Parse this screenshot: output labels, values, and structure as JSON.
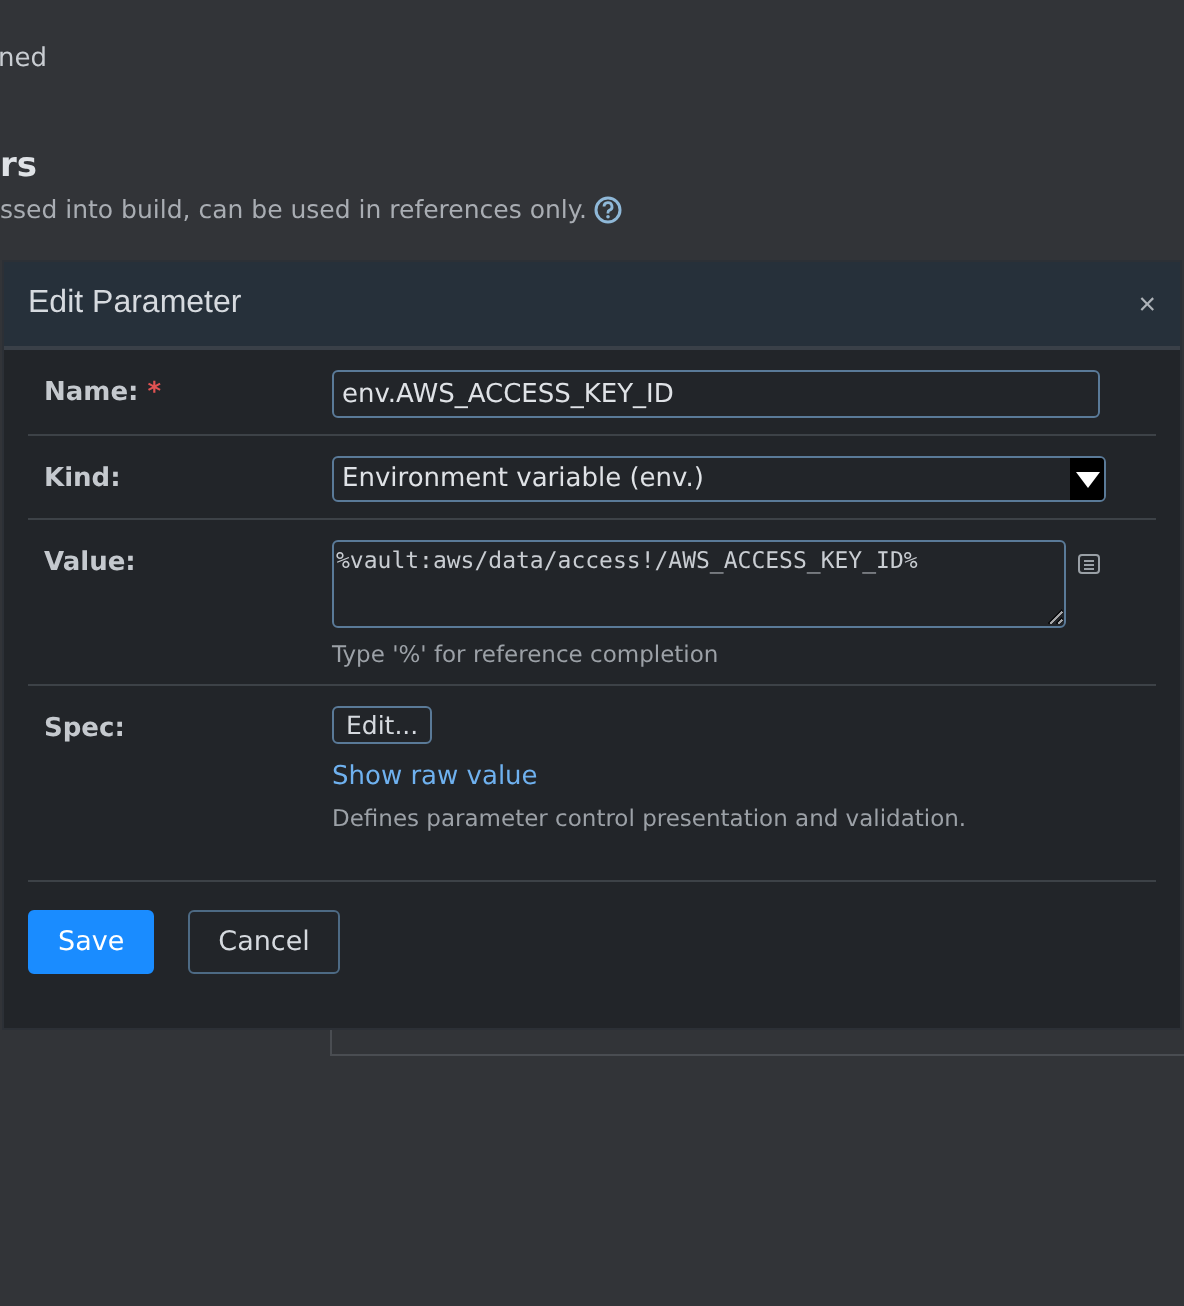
{
  "background": {
    "line_1": "ned",
    "heading": "rs",
    "description": "ssed into build, can be used in references only."
  },
  "dialog": {
    "title": "Edit Parameter",
    "close": "×",
    "fields": [
      {
        "kind": "text",
        "label": "Name:",
        "required_mark": "*",
        "value": "env.AWS_ACCESS_KEY_ID"
      },
      {
        "kind": "select",
        "label": "Kind:",
        "value": "Environment variable (env.)"
      },
      {
        "kind": "textarea",
        "label": "Value:",
        "value": "%vault:aws/data/access!/AWS_ACCESS_KEY_ID%",
        "hint": "Type '%' for reference completion"
      },
      {
        "kind": "spec",
        "label": "Spec:",
        "button": "Edit...",
        "link": "Show raw value",
        "hint": "Defines parameter control presentation and validation."
      }
    ],
    "buttons": [
      {
        "label": "Save",
        "primary": true
      },
      {
        "label": "Cancel",
        "primary": false
      }
    ]
  }
}
